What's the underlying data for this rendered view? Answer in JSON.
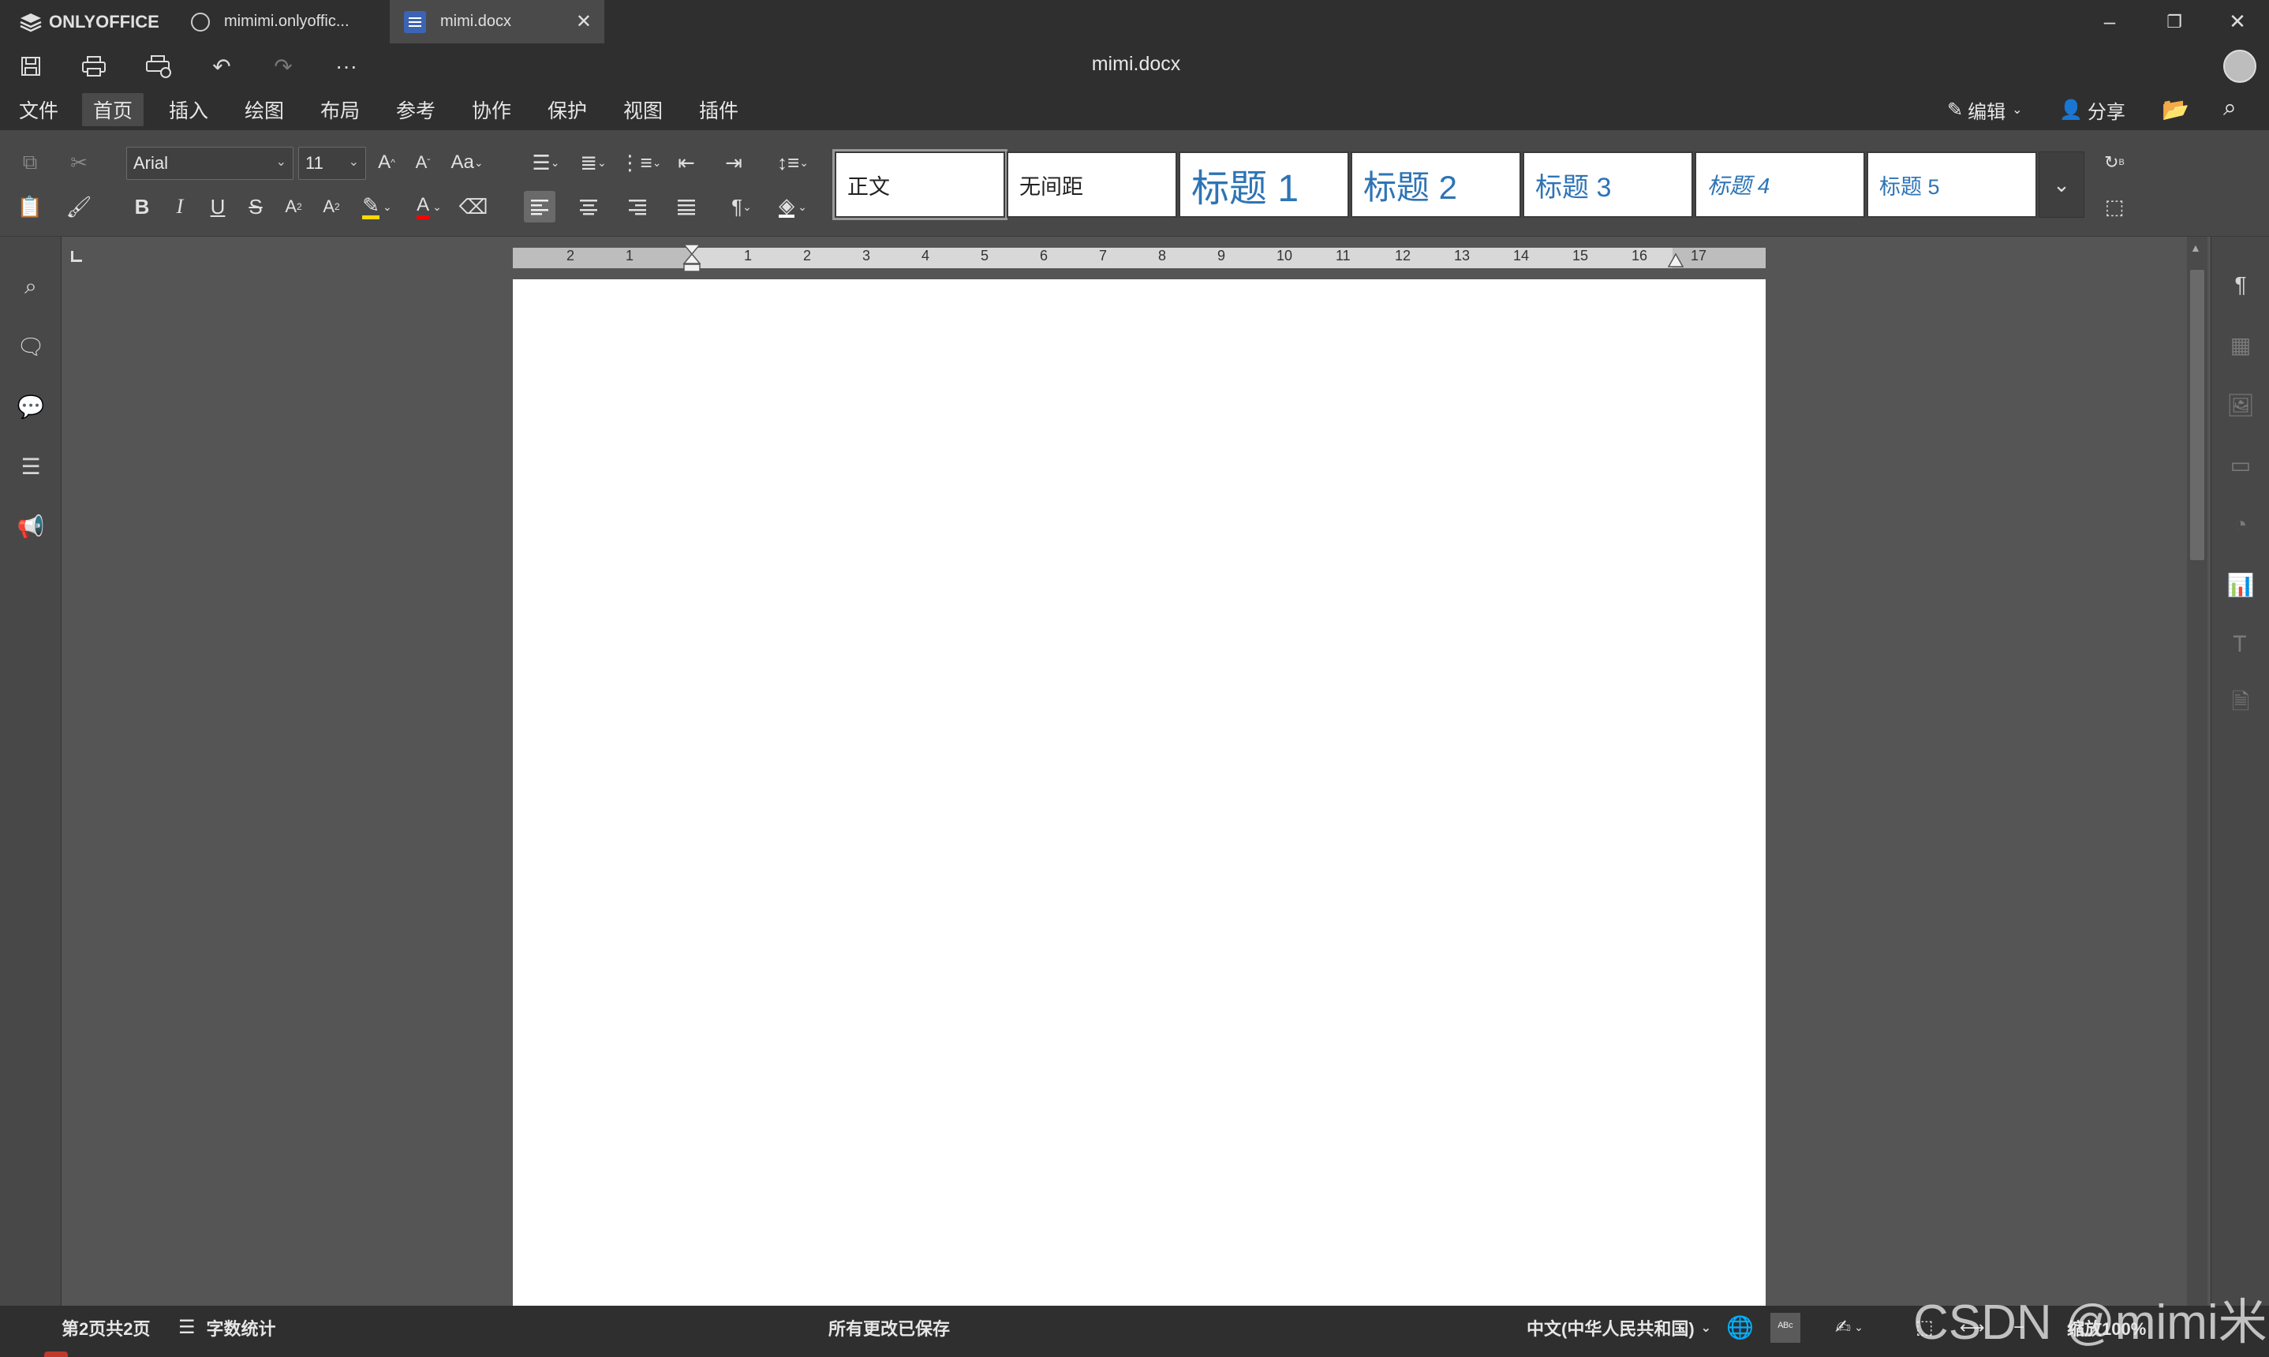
{
  "app": {
    "brand": "ONLYOFFICE",
    "doc_title": "mimi.docx"
  },
  "tabs": [
    {
      "label": "mimimi.onlyoffic..."
    },
    {
      "label": "mimi.docx"
    }
  ],
  "window_controls": {
    "minimize": "–",
    "restore": "❐",
    "close": "✕"
  },
  "menu": {
    "tabs": [
      "文件",
      "首页",
      "插入",
      "绘图",
      "布局",
      "参考",
      "协作",
      "保护",
      "视图",
      "插件"
    ],
    "active": "首页",
    "edit_label": "编辑",
    "share_label": "分享"
  },
  "toolbar": {
    "font_name": "Arial",
    "font_size": "11",
    "styles": [
      {
        "label": "正文"
      },
      {
        "label": "无间距"
      },
      {
        "label": "标题 1"
      },
      {
        "label": "标题 2"
      },
      {
        "label": "标题 3"
      },
      {
        "label": "标题 4"
      },
      {
        "label": "标题 5"
      }
    ]
  },
  "ruler": {
    "labels": [
      "2",
      "1",
      "1",
      "2",
      "3",
      "4",
      "5",
      "6",
      "7",
      "8",
      "9",
      "10",
      "11",
      "12",
      "13",
      "14",
      "15",
      "16",
      "17"
    ]
  },
  "status": {
    "page_info": "第2页共2页",
    "word_count": "字数统计",
    "save_state": "所有更改已保存",
    "language": "中文(中华人民共和国)",
    "zoom": "缩放100%"
  },
  "watermark": "CSDN @mimi米米",
  "colors": {
    "accent_heading": "#2e74b5",
    "highlight_yellow": "#ffd800",
    "font_color_red": "#ff0000",
    "doc_tab_blue": "#3c64b4"
  }
}
